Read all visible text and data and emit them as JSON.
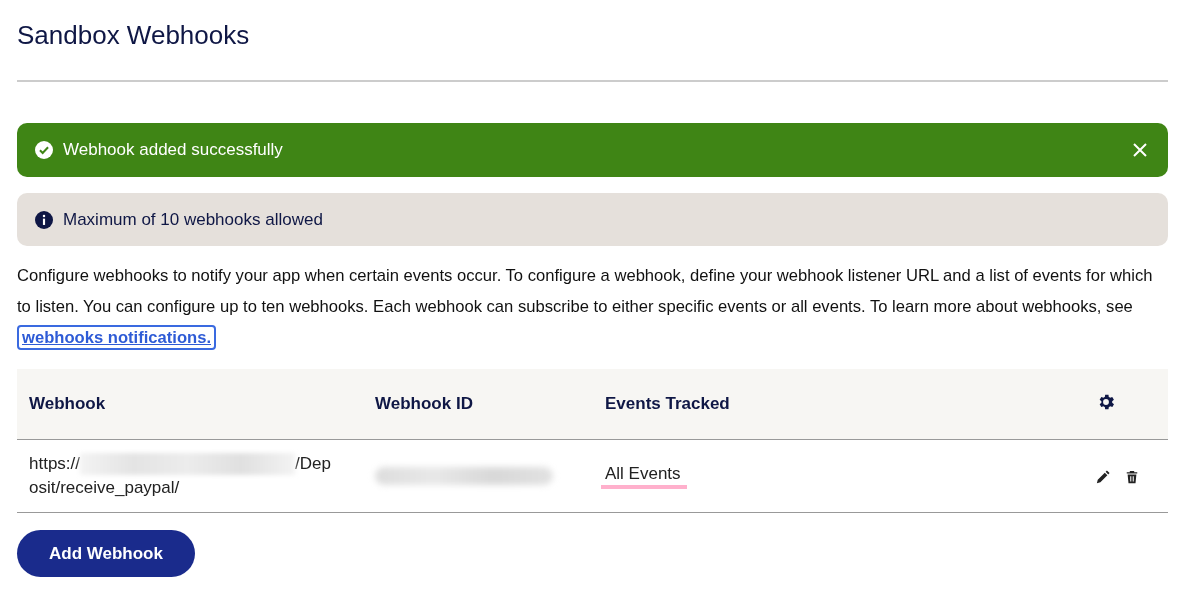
{
  "page": {
    "title": "Sandbox Webhooks"
  },
  "success_alert": {
    "message": "Webhook added successfully",
    "dismissible": true
  },
  "info_alert": {
    "message": "Maximum of 10 webhooks allowed"
  },
  "description": {
    "text": "Configure webhooks to notify your app when certain events occur. To configure a webhook, define your webhook listener URL and a list of events for which to listen. You can configure up to ten webhooks. Each webhook can subscribe to either specific events or all events. To learn more about webhooks, see",
    "link": "webhooks notifications.",
    "link_focused": true
  },
  "table": {
    "columns": [
      "Webhook",
      "Webhook ID",
      "Events Tracked"
    ],
    "rows": [
      {
        "url_prefix": "https://",
        "url_end": "/Dep",
        "url_line_2": "osit/receive_paypal/",
        "events": "All Events",
        "events_highlighted": true
      }
    ]
  },
  "buttons": [
    {
      "label": "Add Webhook"
    }
  ]
}
